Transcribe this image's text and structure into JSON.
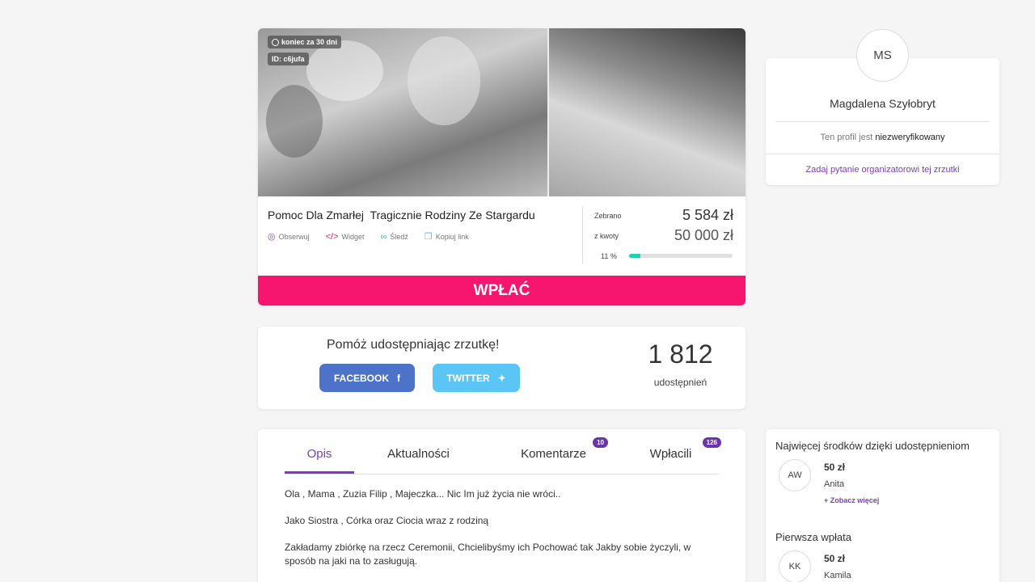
{
  "campaign": {
    "badge_end": "koniec za 30 dni",
    "badge_id": "ID: c6jufa",
    "title": "Pomoc Dla Zmarłej  Tragicznie Rodziny Ze Stargardu",
    "actions": [
      {
        "label": "Obserwuj",
        "icon": "eye-icon"
      },
      {
        "label": "Widget",
        "icon": "code-icon"
      },
      {
        "label": "Śledź",
        "icon": "link-icon"
      },
      {
        "label": "Kopiuj link",
        "icon": "copy-icon"
      }
    ],
    "collected_label": "Zebrano",
    "collected_value": "5 584 zł",
    "goal_label": "z kwoty",
    "goal_value": "50 000 zł",
    "progress_pct_label": "11 %",
    "progress_fraction": 0.11,
    "donate_label": "WPŁAĆ"
  },
  "share": {
    "title": "Pomóż udostępniając zrzutkę!",
    "facebook_label": "FACEBOOK",
    "twitter_label": "TWITTER",
    "count": "1 812",
    "count_label": "udostępnień"
  },
  "tabs": {
    "opis": "Opis",
    "news": "Aktualności",
    "comments": "Komentarze",
    "comments_count": "10",
    "payers": "Wpłacili",
    "payers_count": "126"
  },
  "description": {
    "p1": "Ola , Mama , Zuzia Filip , Majeczka... Nic Im już życia nie wróci..",
    "p2": "Jako Siostra , Córka oraz Ciocia wraz z rodziną",
    "p3": "Zakładamy zbiórkę na rzecz Ceremonii,  Chcielibyśmy ich Pochować tak Jakby sobie życzyli,  w sposób na jaki na to zasługują."
  },
  "organizer": {
    "initials": "MS",
    "name": "Magdalena Szyłobryt",
    "verify_prefix": "Ten profil jest ",
    "verify_status": "niezweryfikowany",
    "ask_link": "Zadaj pytanie organizatorowi tej zrzutki"
  },
  "top_share": {
    "heading": "Najwięcej środków dzięki udostępnieniom",
    "initials": "AW",
    "amount": "50 zł",
    "name": "Anita",
    "more": "+ Zobacz więcej"
  },
  "first_payment": {
    "heading": "Pierwsza wpłata",
    "initials": "KK",
    "amount": "50 zł",
    "name": "Kamila"
  },
  "colors": {
    "accent_pink": "#f6166f",
    "accent_purple": "#7b3fb0",
    "progress": "#1dd3b0",
    "facebook": "#4d73c9",
    "twitter": "#5bc5f5"
  }
}
